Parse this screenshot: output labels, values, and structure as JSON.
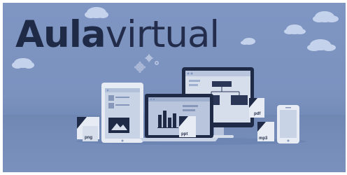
{
  "banner": {
    "title_part1": "Aula",
    "title_part2": "virtual",
    "file_badges": {
      "word": "W",
      "pdf": "pdf",
      "ppt": "ppt",
      "mp3": "mp3",
      "png": "png"
    }
  },
  "colors": {
    "background": "#7f95c2",
    "title_text": "#1f2a47",
    "cloud": "#c4d2ec",
    "device_frame": "#d8e0ee",
    "screen_dark": "#1f2a47"
  },
  "icons": [
    "cloud-icon",
    "gear-icon",
    "desktop-monitor-icon",
    "laptop-icon",
    "tablet-icon",
    "smartphone-icon",
    "document-icon"
  ]
}
